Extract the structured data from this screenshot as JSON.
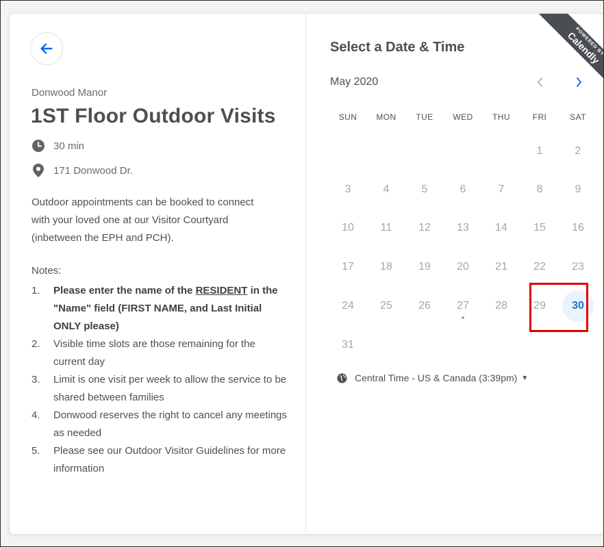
{
  "event": {
    "organization": "Donwood Manor",
    "title": "1ST Floor Outdoor Visits",
    "duration": "30 min",
    "location": "171 Donwood Dr.",
    "description": "Outdoor appointments can be booked to connect with your loved one at our Visitor Courtyard (inbetween the EPH and PCH).",
    "notes_label": "Notes:",
    "note1": {
      "num": "1.",
      "part1": "Please enter the name of the ",
      "part2": "RESIDENT",
      "part3": " in the \"Name\" field (FIRST NAME, and Last Initial ",
      "part4": "ONLY",
      "part5": " please)"
    },
    "notes": [
      {
        "num": "2.",
        "text": "Visible time slots are those remaining for the current day"
      },
      {
        "num": "3.",
        "text": "Limit is one visit per week to allow the service to be shared between families"
      },
      {
        "num": "4.",
        "text": "Donwood reserves the right to cancel any meetings as needed"
      },
      {
        "num": "5.",
        "text": "Please see our Outdoor Visitor Guidelines for more information"
      }
    ]
  },
  "calendar": {
    "heading": "Select a Date & Time",
    "month": "May 2020",
    "weekdays": [
      "SUN",
      "MON",
      "TUE",
      "WED",
      "THU",
      "FRI",
      "SAT"
    ],
    "days": [
      "1",
      "2",
      "3",
      "4",
      "5",
      "6",
      "7",
      "8",
      "9",
      "10",
      "11",
      "12",
      "13",
      "14",
      "15",
      "16",
      "17",
      "18",
      "19",
      "20",
      "21",
      "22",
      "23",
      "24",
      "25",
      "26",
      "27",
      "28",
      "29",
      "30",
      "31"
    ],
    "selected_day": "30",
    "today_marker_day": "27",
    "timezone": "Central Time - US & Canada (3:39pm)"
  },
  "badge": {
    "powered_by": "POWERED BY",
    "brand": "Calendly"
  },
  "colors": {
    "accent": "#0069ff",
    "available_bg": "#e9f3fd",
    "highlight": "#e00000"
  }
}
